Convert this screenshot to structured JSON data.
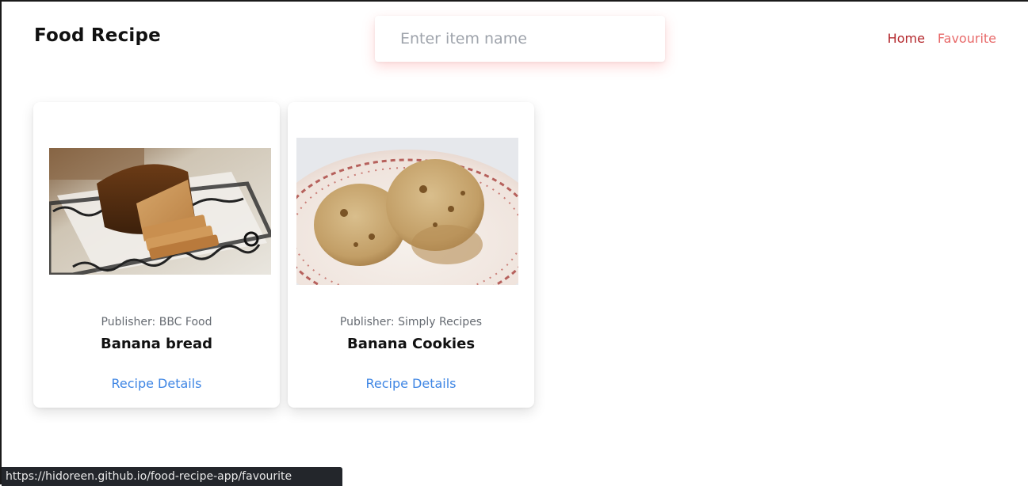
{
  "header": {
    "title": "Food Recipe",
    "search": {
      "placeholder": "Enter item name",
      "value": ""
    },
    "nav": [
      {
        "label": "Home",
        "color": "#b3262b"
      },
      {
        "label": "Favourite",
        "color": "#e86a6a"
      }
    ]
  },
  "recipes": [
    {
      "publisher": "Publisher: BBC Food",
      "title": "Banana bread",
      "link_label": "Recipe Details"
    },
    {
      "publisher": "Publisher: Simply Recipes",
      "title": "Banana Cookies",
      "link_label": "Recipe Details"
    }
  ],
  "status_bar": {
    "url": "https://hidoreen.github.io/food-recipe-app/favourite"
  },
  "colors": {
    "link": "#3f86e4",
    "title": "#111111"
  }
}
